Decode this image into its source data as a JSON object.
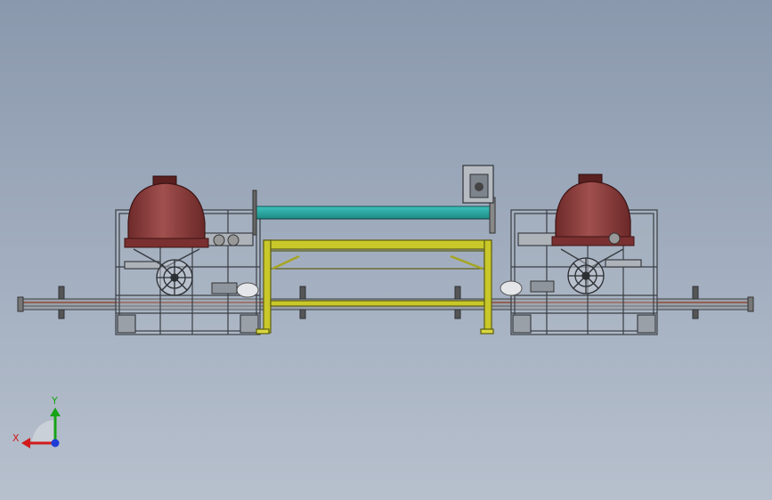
{
  "triad": {
    "x_label": "X",
    "y_label": "Y",
    "colors": {
      "x": "#d11a1a",
      "y": "#17a317",
      "z": "#1e3bd6"
    }
  },
  "colors": {
    "tank": "#8a3a3a",
    "frame": "#c8ccd3",
    "table": "#c9c82a",
    "belt": "#27a6a0",
    "rail": "#8f4a3a"
  }
}
